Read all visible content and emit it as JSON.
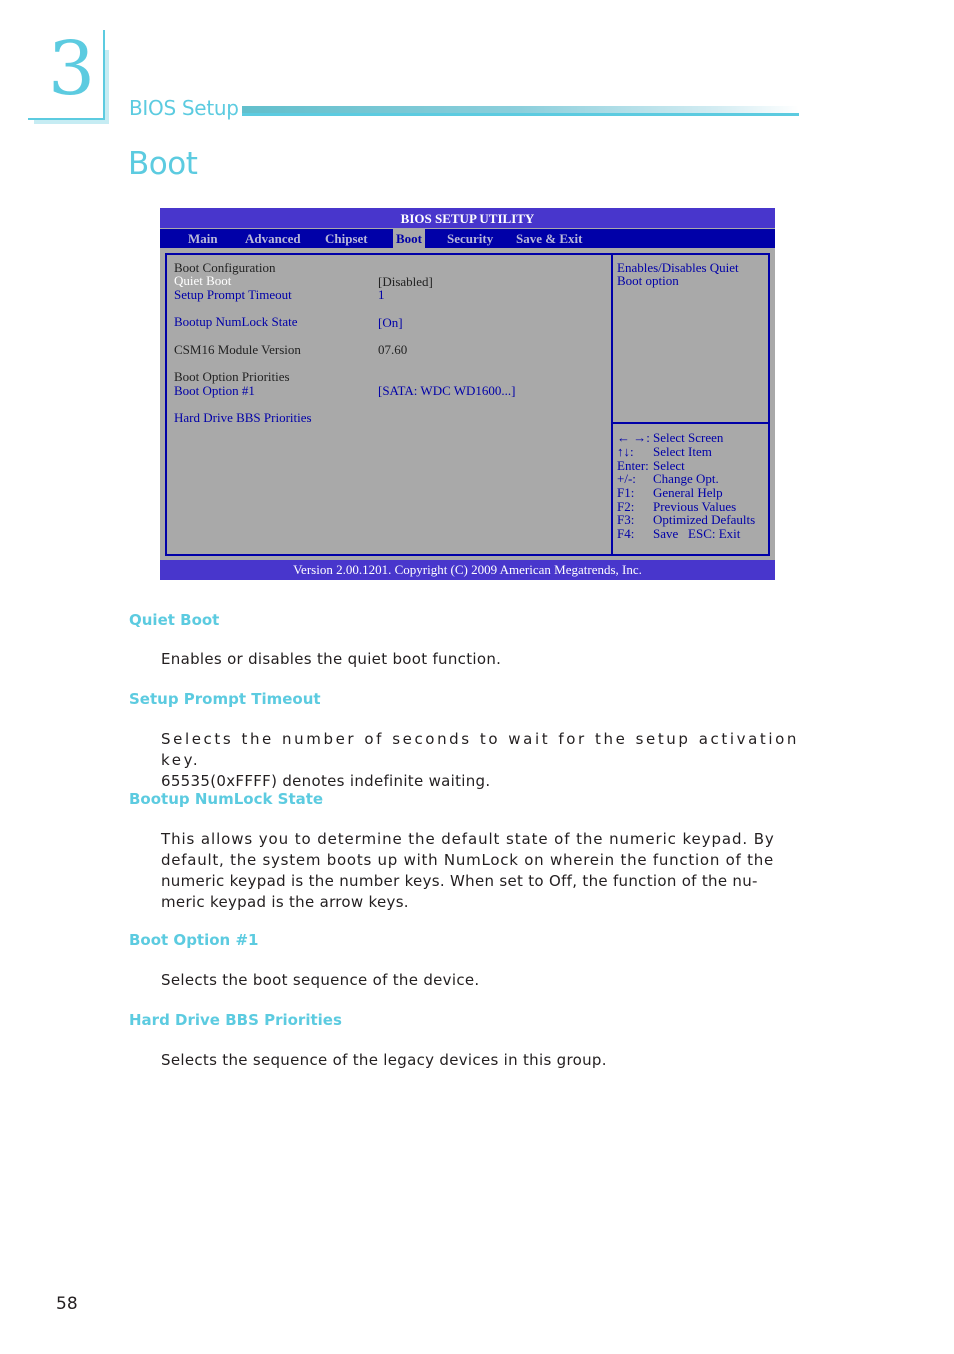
{
  "chapter": {
    "number": "3",
    "section_label": "BIOS Setup"
  },
  "page_title": "Boot",
  "bios": {
    "title": "BIOS SETUP UTILITY",
    "tabs": [
      {
        "label": "Main",
        "active": false
      },
      {
        "label": "Advanced",
        "active": false
      },
      {
        "label": "Chipset",
        "active": false
      },
      {
        "label": "Boot",
        "active": true
      },
      {
        "label": "Security",
        "active": false
      },
      {
        "label": "Save & Exit",
        "active": false
      }
    ],
    "items": {
      "boot_configuration_heading": "Boot Configuration",
      "quiet_boot": {
        "label": "Quiet Boot",
        "value": "[Disabled]"
      },
      "setup_prompt_timeout": {
        "label": "Setup Prompt Timeout",
        "value": "1"
      },
      "bootup_numlock_state": {
        "label": "Bootup NumLock State",
        "value": "[On]"
      },
      "csm16_module_version": {
        "label": "CSM16 Module Version",
        "value": "07.60"
      },
      "boot_option_priorities_heading": "Boot Option Priorities",
      "boot_option_1": {
        "label": "Boot Option #1",
        "value": "[SATA: WDC WD1600...]"
      },
      "hard_drive_bbs_priorities": {
        "label": "Hard Drive BBS Priorities"
      }
    },
    "help_text": [
      "Enables/Disables Quiet",
      "Boot option"
    ],
    "keys": [
      {
        "key": "← →:",
        "action": "Select Screen"
      },
      {
        "key": "↑↓:",
        "action": "Select Item"
      },
      {
        "key": "Enter:",
        "action": "Select"
      },
      {
        "key": "+/-:",
        "action": "Change Opt."
      },
      {
        "key": "F1:",
        "action": "General Help"
      },
      {
        "key": "F2:",
        "action": "Previous Values"
      },
      {
        "key": "F3:",
        "action": "Optimized Defaults"
      },
      {
        "key": "F4:",
        "action": "Save   ESC: Exit"
      }
    ],
    "footer": "Version 2.00.1201. Copyright (C) 2009 American Megatrends, Inc."
  },
  "sections": [
    {
      "heading": "Quiet Boot",
      "body": "Enables or disables the quiet boot function."
    },
    {
      "heading": "Setup Prompt Timeout",
      "body_lines": [
        "Selects the number of seconds to wait for the setup activation key.",
        "65535(0xFFFF) denotes indefinite waiting."
      ]
    },
    {
      "heading": "Bootup NumLock State",
      "body_lines": [
        "This allows you to determine the default state of the numeric keypad. By",
        "default, the system boots up with NumLock on wherein the function of the",
        "numeric keypad is the number keys. When set to Off, the function of the nu-",
        "meric keypad is the arrow keys."
      ]
    },
    {
      "heading": "Boot Option #1",
      "body": "Selects the boot sequence of the device."
    },
    {
      "heading": "Hard Drive BBS Priorities",
      "body": "Selects the sequence of the legacy devices in this group."
    }
  ],
  "page_number": "58"
}
